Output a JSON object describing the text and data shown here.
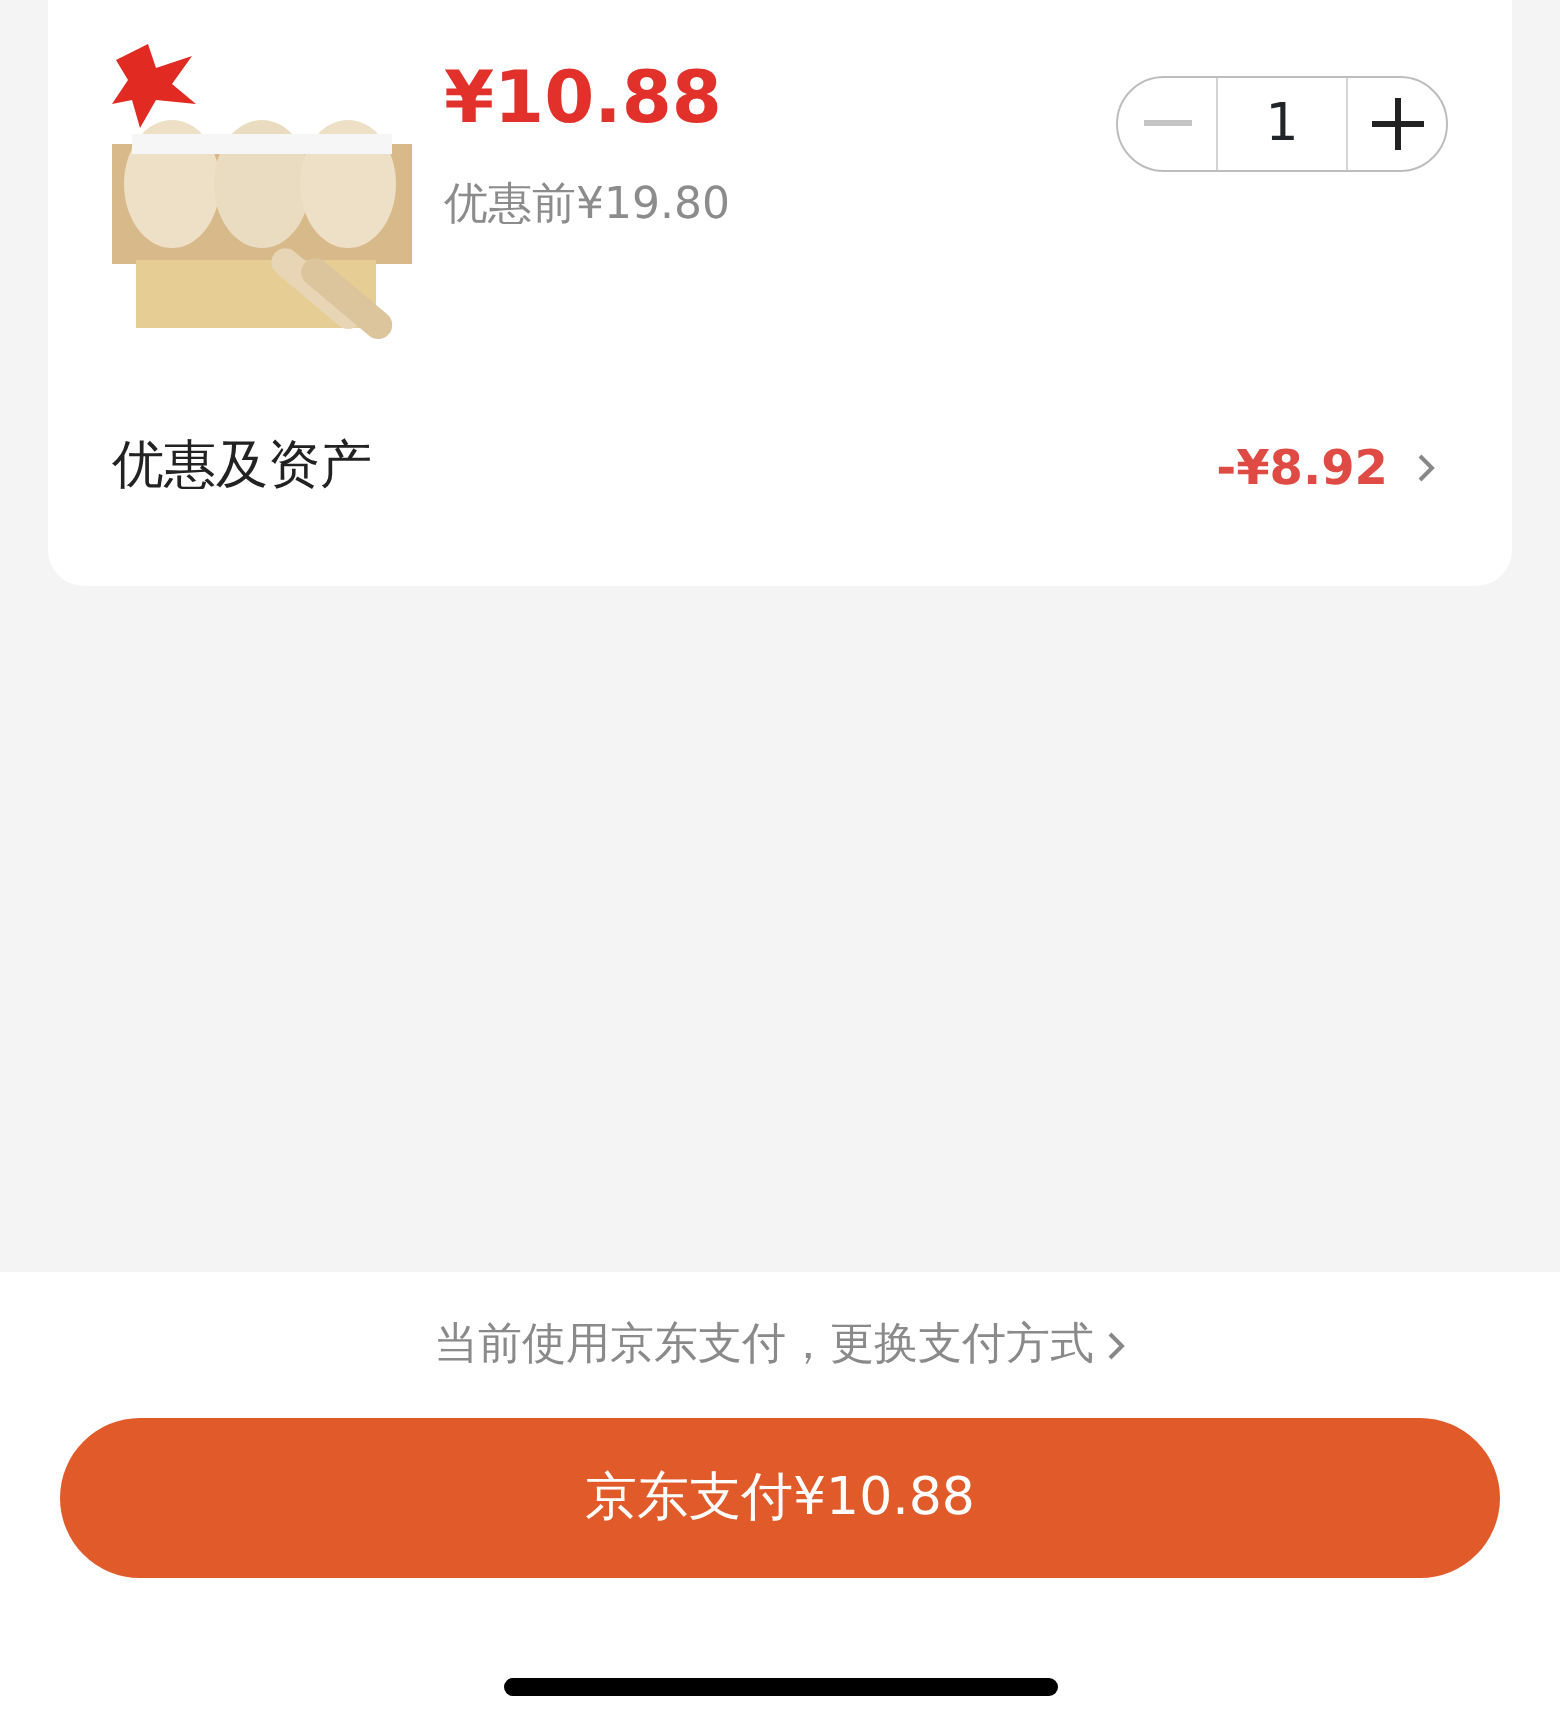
{
  "product": {
    "kind": "picture",
    "price": "¥10.88",
    "original_price": "优惠前¥19.80"
  },
  "quantity": {
    "value": "1",
    "minus_disabled": true
  },
  "discount": {
    "label": "优惠及资产",
    "amount": "-¥8.92"
  },
  "payment": {
    "hint": "当前使用京东支付，更换支付方式",
    "button": "京东支付¥10.88"
  }
}
